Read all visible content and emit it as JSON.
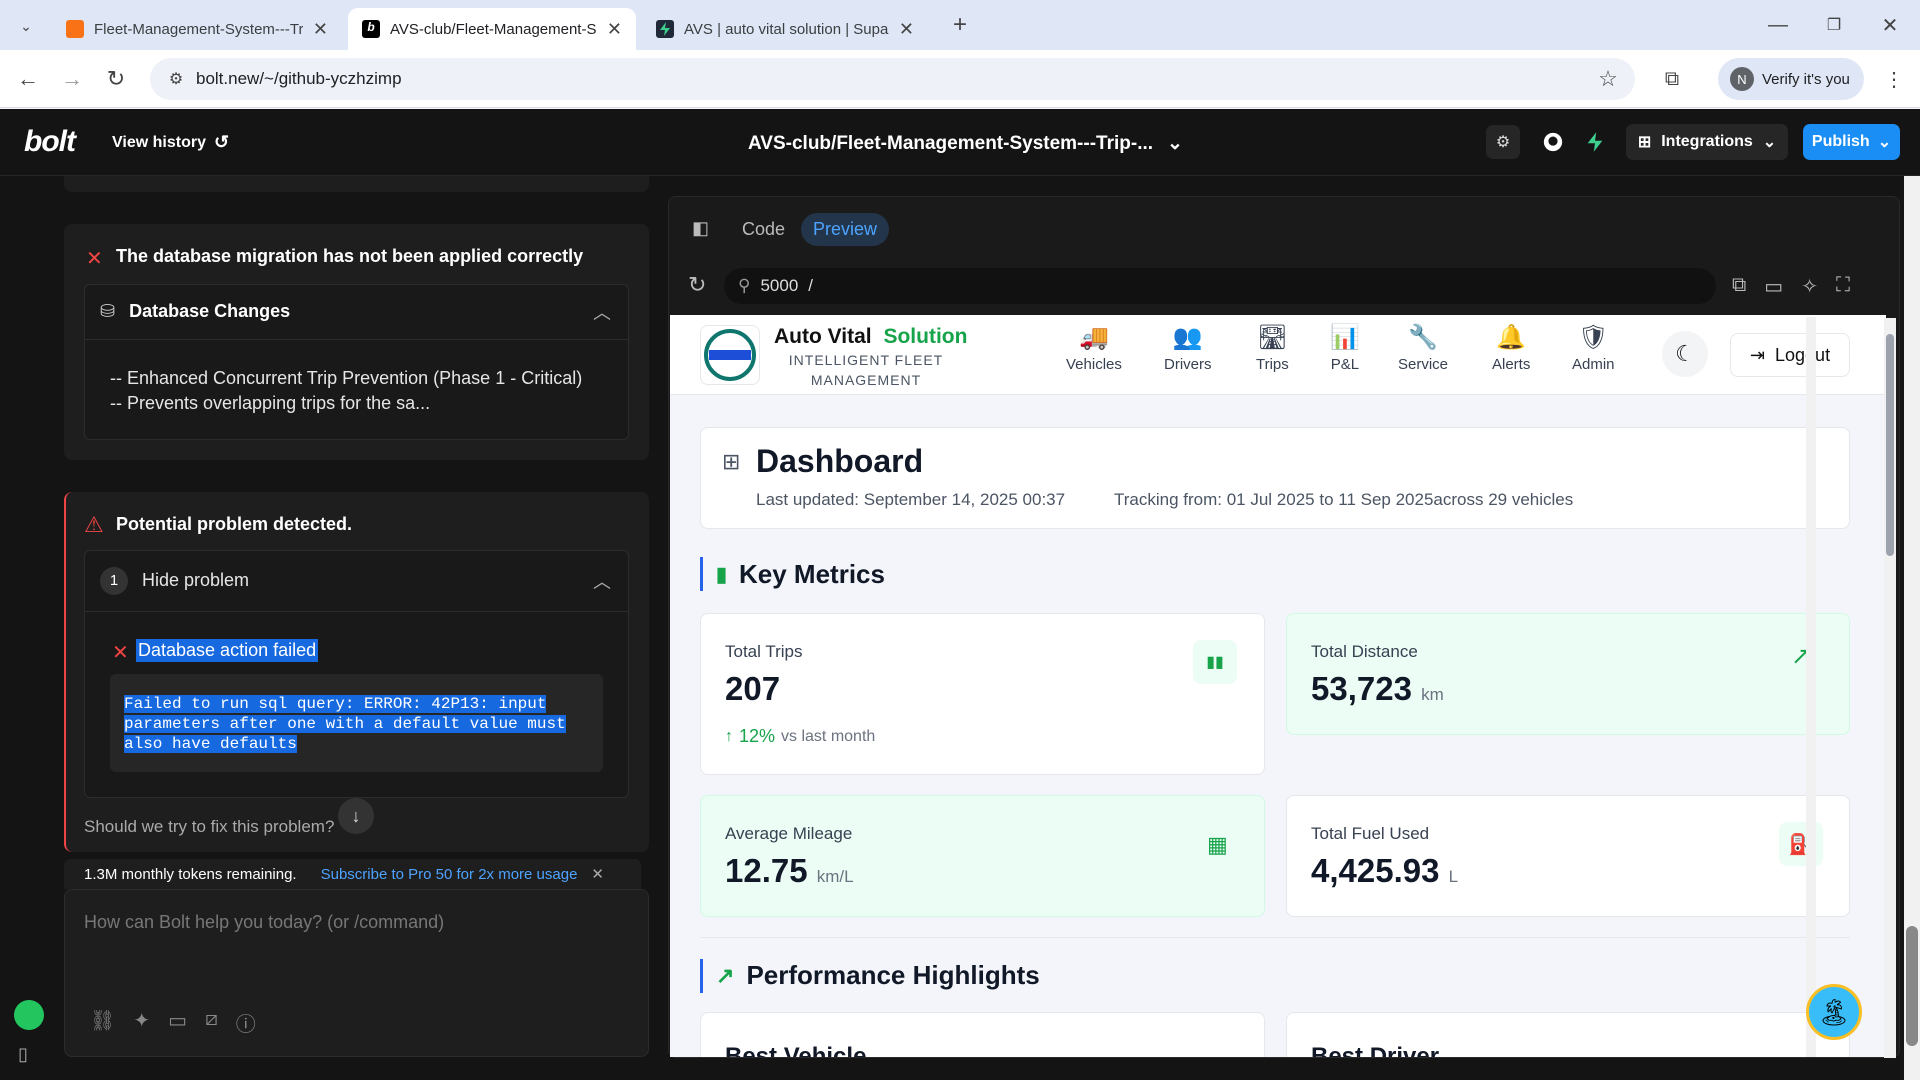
{
  "browser": {
    "tabs": [
      {
        "title": "Fleet-Management-System---Tr",
        "favicon_color": "#f97316"
      },
      {
        "title": "AVS-club/Fleet-Management-S",
        "favicon_color": "#000000"
      },
      {
        "title": "AVS | auto vital solution | Supab",
        "favicon_color": "#10b981"
      }
    ],
    "url": "bolt.new/~/github-yczhzimp",
    "profile_initial": "N",
    "profile_label": "Verify it's you"
  },
  "bolt": {
    "logo": "bolt",
    "view_history": "View history",
    "project_title": "AVS-club/Fleet-Management-System---Trip-...",
    "integrations": "Integrations",
    "publish": "Publish",
    "accent": "#1b8ef6"
  },
  "chat": {
    "migration_error": "The database migration has not been applied correctly",
    "db_changes_title": "Database Changes",
    "db_changes_line1": "-- Enhanced Concurrent Trip Prevention (Phase 1 - Critical)",
    "db_changes_line2": "-- Prevents overlapping trips for the sa...",
    "problem_title": "Potential problem detected.",
    "problem_number": "1",
    "hide_problem": "Hide problem",
    "action_failed": "Database action failed",
    "error_line1": "Failed to run sql query: ERROR:  42P13: input",
    "error_line2": "parameters after one with a default value must",
    "error_line3": "also have defaults",
    "fix_prompt": "Should we try to fix this problem?",
    "tokens_remaining": "1.3M monthly tokens remaining.",
    "subscribe": "Subscribe to Pro 50 for 2x more usage",
    "input_placeholder": "How can Bolt help you today? (or /command)"
  },
  "panel": {
    "tab_code": "Code",
    "tab_preview": "Preview",
    "port": "5000",
    "path": "/"
  },
  "app": {
    "brand1": "Auto Vital",
    "brand2": "Solution",
    "tagline1": "INTELLIGENT FLEET",
    "tagline2": "MANAGEMENT",
    "logo_text": "AUTO VITAL SOLUTION",
    "nav": [
      "Vehicles",
      "Drivers",
      "Trips",
      "P&L",
      "Service",
      "Alerts",
      "Admin"
    ],
    "logout": "Logout",
    "dashboard_title": "Dashboard",
    "last_updated": "Last updated: September 14, 2025 00:37",
    "tracking": "Tracking from: 01 Jul 2025 to 11 Sep 2025across 29 vehicles",
    "key_metrics": "Key Metrics",
    "metrics": [
      {
        "label": "Total Trips",
        "value": "207",
        "unit": "",
        "trend": "12%",
        "trend_text": "vs last month"
      },
      {
        "label": "Total Distance",
        "value": "53,723",
        "unit": "km"
      },
      {
        "label": "Average Mileage",
        "value": "12.75",
        "unit": "km/L"
      },
      {
        "label": "Total Fuel Used",
        "value": "4,425.93",
        "unit": "L"
      }
    ],
    "performance": "Performance Highlights",
    "best_vehicle": "Best Vehicle",
    "best_driver": "Best Driver",
    "green": "#16a34a"
  }
}
